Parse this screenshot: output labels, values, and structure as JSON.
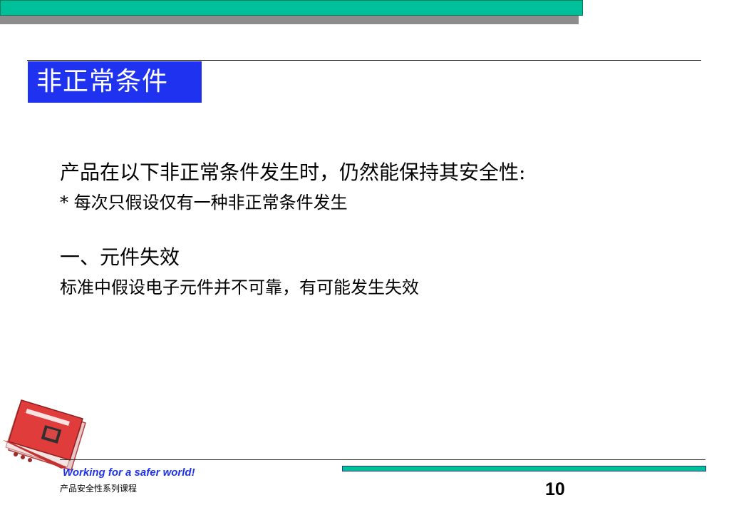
{
  "header": {
    "title": "非正常条件"
  },
  "content": {
    "line1": "产品在以下非正常条件发生时，仍然能保持其安全性:",
    "line2": "* 每次只假设仅有一种非正常条件发生",
    "section1_heading": "一、元件失效",
    "section1_body": "标准中假设电子元件并不可靠，有可能发生失效"
  },
  "footer": {
    "slogan": "Working for a safer world!",
    "course": "产品安全性系列课程",
    "page_number": "10",
    "logo_icon": "operation-manual-book-icon"
  },
  "colors": {
    "accent_green": "#00c09a",
    "title_blue": "#1f32f0",
    "shadow_gray": "#8c8c8c"
  }
}
